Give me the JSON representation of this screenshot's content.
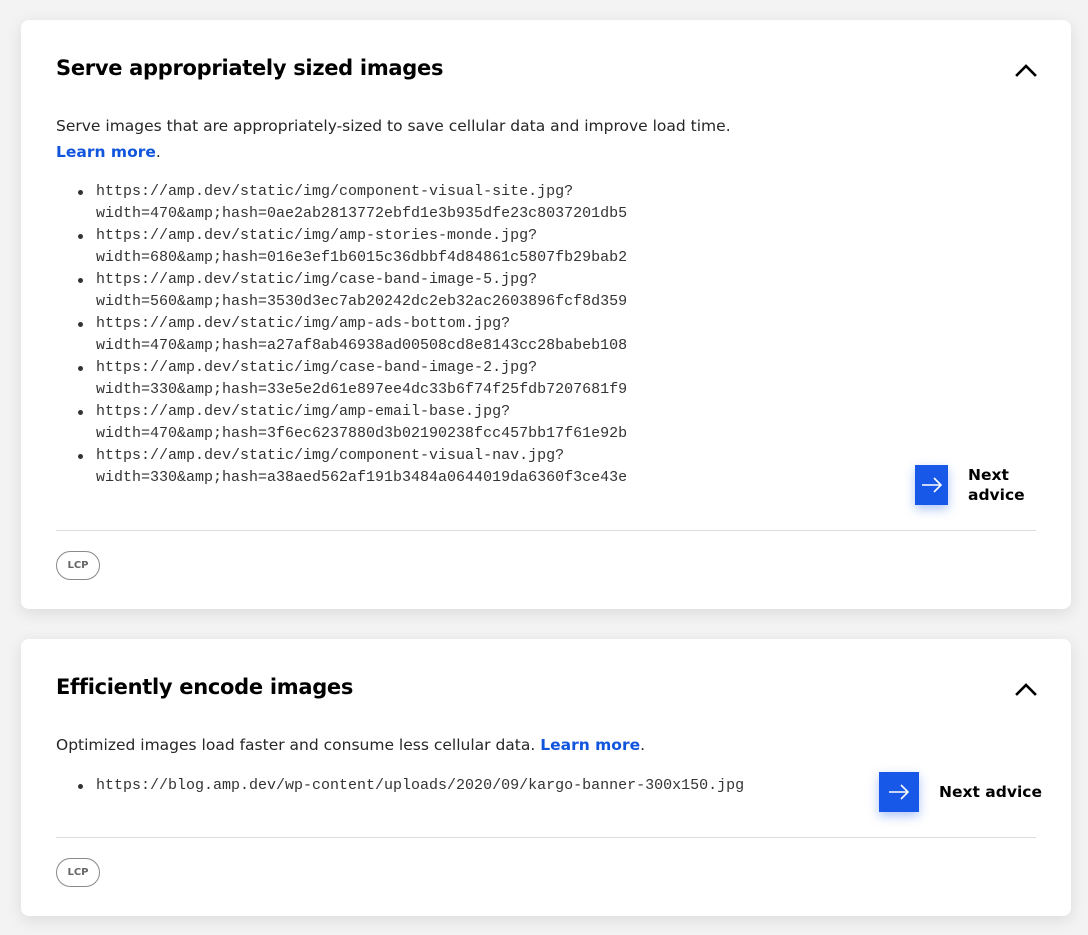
{
  "cards": [
    {
      "title": "Serve appropriately sized images",
      "description": "Serve images that are appropriately-sized to save cellular data and improve load time. ",
      "learn_more": "Learn more",
      "trailing": ".",
      "urls": [
        {
          "line1": "https://amp.dev/static/img/component-visual-site.jpg?",
          "line2": "width=470&amp;hash=0ae2ab2813772ebfd1e3b935dfe23c8037201db5"
        },
        {
          "line1": "https://amp.dev/static/img/amp-stories-monde.jpg?",
          "line2": "width=680&amp;hash=016e3ef1b6015c36dbbf4d84861c5807fb29bab2"
        },
        {
          "line1": "https://amp.dev/static/img/case-band-image-5.jpg?",
          "line2": "width=560&amp;hash=3530d3ec7ab20242dc2eb32ac2603896fcf8d359"
        },
        {
          "line1": "https://amp.dev/static/img/amp-ads-bottom.jpg?",
          "line2": "width=470&amp;hash=a27af8ab46938ad00508cd8e8143cc28babeb108"
        },
        {
          "line1": "https://amp.dev/static/img/case-band-image-2.jpg?",
          "line2": "width=330&amp;hash=33e5e2d61e897ee4dc33b6f74f25fdb7207681f9"
        },
        {
          "line1": "https://amp.dev/static/img/amp-email-base.jpg?",
          "line2": "width=470&amp;hash=3f6ec6237880d3b02190238fcc457bb17f61e92b"
        },
        {
          "line1": "https://amp.dev/static/img/component-visual-nav.jpg?",
          "line2": "width=330&amp;hash=a38aed562af191b3484a0644019da6360f3ce43e"
        }
      ],
      "next_label": "Next advice",
      "tag": "LCP"
    },
    {
      "title": "Efficiently encode images",
      "description": "Optimized images load faster and consume less cellular data. ",
      "learn_more": "Learn more",
      "trailing": ".",
      "urls": [
        {
          "line1": "https://blog.amp.dev/wp-content/uploads/2020/09/kargo-banner-300x150.jpg",
          "line2": ""
        }
      ],
      "next_label": "Next advice",
      "tag": "LCP"
    }
  ],
  "colors": {
    "accent": "#1858e8",
    "link": "#1155dd",
    "background": "#f3f3f3"
  },
  "icons": {
    "collapse": "chevron-up-icon",
    "next": "arrow-right-icon"
  }
}
